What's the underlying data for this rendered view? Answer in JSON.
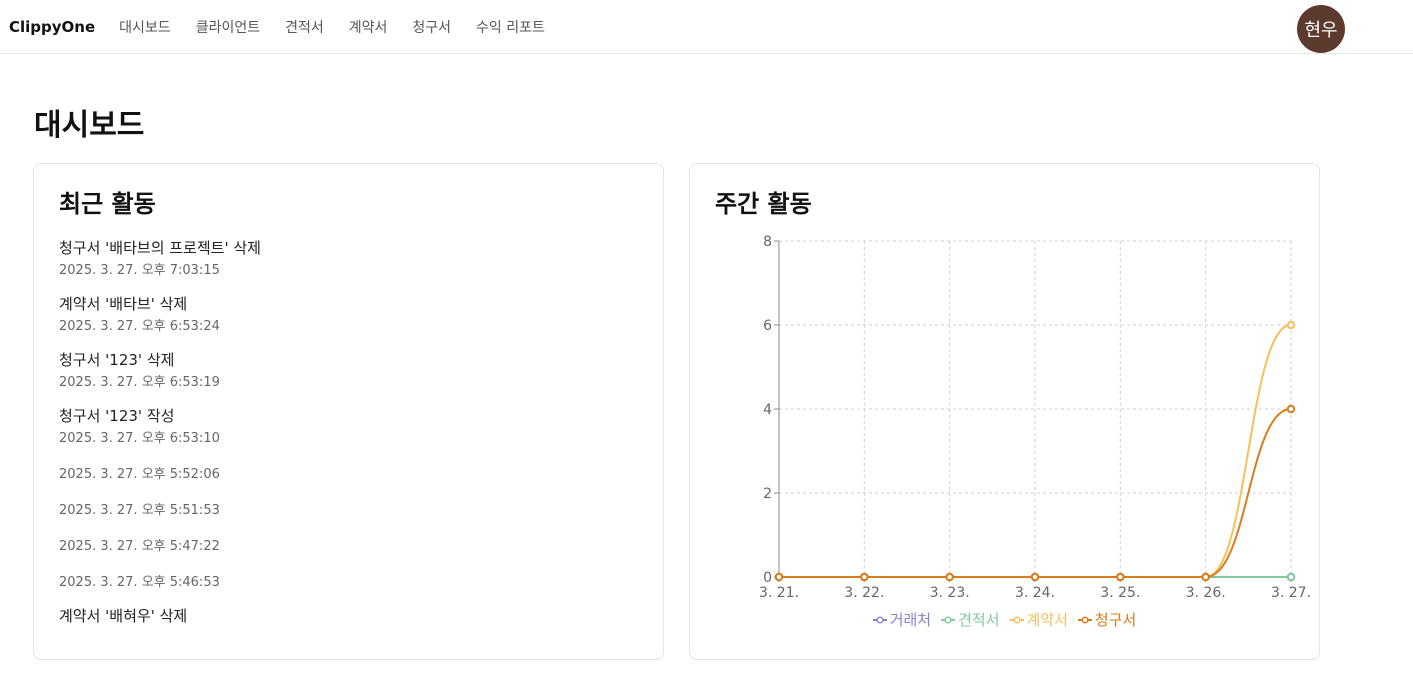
{
  "nav": {
    "brand": "ClippyOne",
    "items": [
      "대시보드",
      "클라이언트",
      "견적서",
      "계약서",
      "청구서",
      "수익 리포트"
    ],
    "avatar": "현우",
    "avatar_color": "#5d3a2e"
  },
  "page": {
    "title": "대시보드"
  },
  "recent": {
    "title": "최근 활동",
    "items": [
      {
        "text": "청구서 '배타브의 프로젝트' 삭제",
        "time": "2025. 3. 27. 오후 7:03:15"
      },
      {
        "text": "계약서 '배타브' 삭제",
        "time": "2025. 3. 27. 오후 6:53:24"
      },
      {
        "text": "청구서 '123' 삭제",
        "time": "2025. 3. 27. 오후 6:53:19"
      },
      {
        "text": "청구서 '123' 작성",
        "time": "2025. 3. 27. 오후 6:53:10"
      },
      {
        "text": "",
        "time": "2025. 3. 27. 오후 5:52:06"
      },
      {
        "text": "",
        "time": "2025. 3. 27. 오후 5:51:53"
      },
      {
        "text": "",
        "time": "2025. 3. 27. 오후 5:47:22"
      },
      {
        "text": "",
        "time": "2025. 3. 27. 오후 5:46:53"
      },
      {
        "text": "계약서 '배혀우' 삭제",
        "time": ""
      }
    ]
  },
  "weekly": {
    "title": "주간 활동"
  },
  "chart_data": {
    "type": "line",
    "categories": [
      "3. 21.",
      "3. 22.",
      "3. 23.",
      "3. 24.",
      "3. 25.",
      "3. 26.",
      "3. 27."
    ],
    "ylim": [
      0,
      8
    ],
    "yticks": [
      0,
      2,
      4,
      6,
      8
    ],
    "grid": true,
    "legend_position": "bottom",
    "series": [
      {
        "name": "거래처",
        "color": "#8884d8",
        "values": [
          0,
          0,
          0,
          0,
          0,
          0,
          0
        ]
      },
      {
        "name": "견적서",
        "color": "#82ca9d",
        "values": [
          0,
          0,
          0,
          0,
          0,
          0,
          0
        ]
      },
      {
        "name": "계약서",
        "color": "#f2c25b",
        "values": [
          0,
          0,
          0,
          0,
          0,
          0,
          6
        ]
      },
      {
        "name": "청구서",
        "color": "#d97c1c",
        "values": [
          0,
          0,
          0,
          0,
          0,
          0,
          4
        ]
      }
    ]
  }
}
